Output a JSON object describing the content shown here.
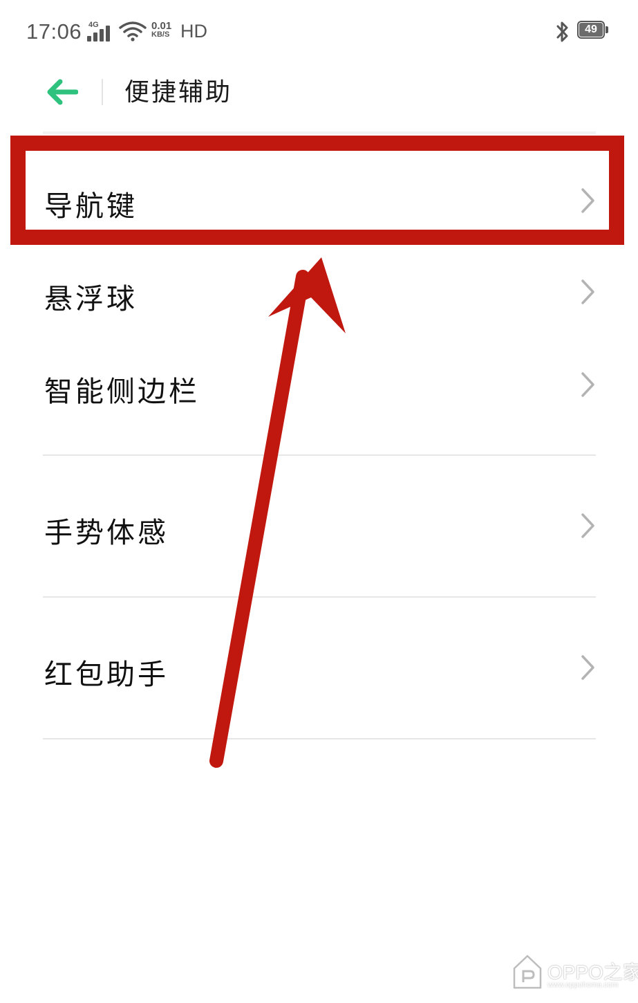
{
  "status_bar": {
    "time": "17:06",
    "network_type": "4G",
    "speed_value": "0.01",
    "speed_unit": "KB/S",
    "hd": "HD",
    "battery_level": "49",
    "icons": [
      "signal-icon",
      "wifi-icon",
      "bluetooth-icon",
      "battery-icon"
    ]
  },
  "header": {
    "title": "便捷辅助",
    "back_icon": "back-arrow-icon"
  },
  "menu": {
    "items": [
      {
        "label": "导航键"
      },
      {
        "label": "悬浮球"
      },
      {
        "label": "智能侧边栏"
      },
      {
        "label": "手势体感"
      },
      {
        "label": "红包助手"
      }
    ]
  },
  "watermark": {
    "text": "OPPO之家",
    "url": "www.oppohome.com"
  },
  "colors": {
    "accent": "#2ec27e",
    "annotation": "#c0170f",
    "status_text": "#555555",
    "divider": "#e6e6e6"
  }
}
